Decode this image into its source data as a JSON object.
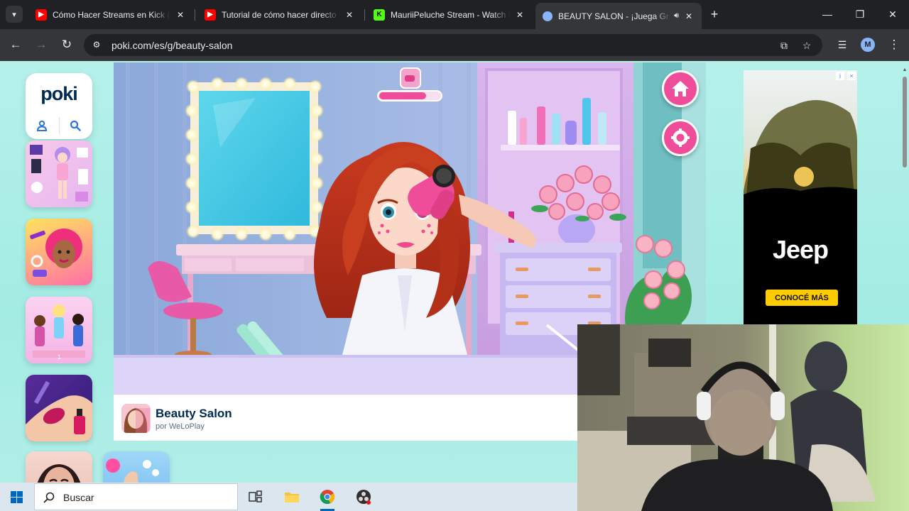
{
  "browser": {
    "tabs": [
      {
        "title": "Cómo Hacer Streams en Kick (C",
        "favicon": "youtube-icon",
        "color": "#ff0000",
        "active": false
      },
      {
        "title": "Tutorial de cómo hacer directo",
        "favicon": "youtube-icon",
        "color": "#ff0000",
        "active": false
      },
      {
        "title": "MauriiPeluche Stream - Watch l",
        "favicon": "kick-icon",
        "color": "#53fc18",
        "active": false
      },
      {
        "title": "BEAUTY SALON - ¡Juega Gr",
        "favicon": "poki-icon",
        "color": "#8ab4f8",
        "active": true
      }
    ],
    "url": "poki.com/es/g/beauty-salon",
    "profile_initial": "M"
  },
  "poki": {
    "logo": "poki",
    "game": {
      "title": "Beauty Salon",
      "author": "por WeLoPlay"
    }
  },
  "ad": {
    "brand": "Jeep",
    "cta": "CONOCÉ MÁS"
  },
  "taskbar": {
    "search_placeholder": "Buscar"
  },
  "colors": {
    "page_bg": "#a3ece3",
    "accent_pink": "#ef4d9a",
    "poki_navy": "#002b50",
    "poki_blue": "#2a76dd",
    "ad_cta": "#ffcc00"
  }
}
